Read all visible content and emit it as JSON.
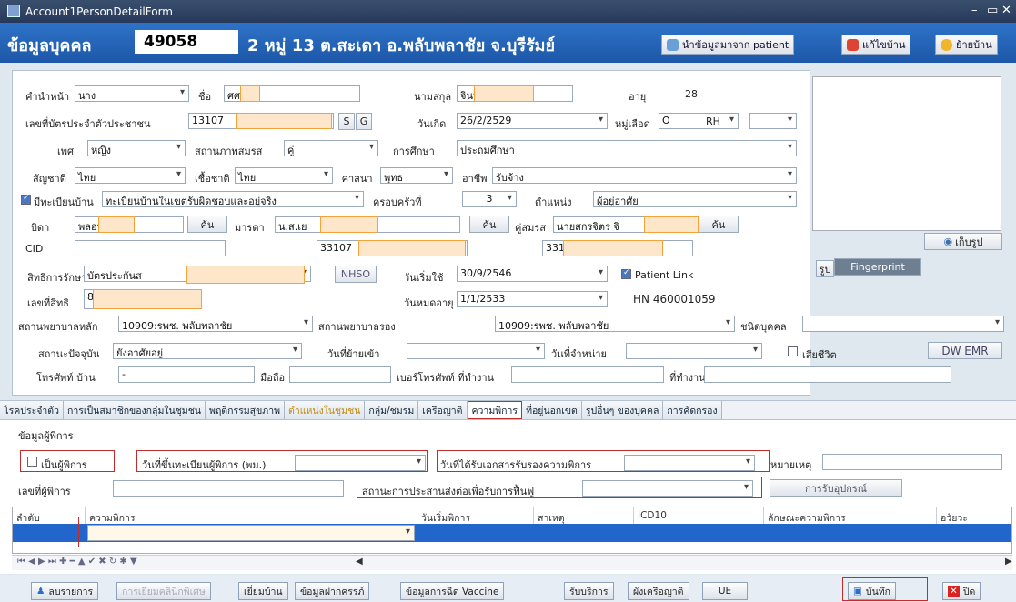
{
  "window": {
    "title": "Account1PersonDetailForm"
  },
  "header": {
    "label": "ข้อมูลบุคคล",
    "person_id": "49058",
    "address": "2 หมู่ 13 ต.สะเดา อ.พลับพลาชัย จ.บุรีรัมย์",
    "btn_import": "นำข้อมูลมาจาก patient",
    "btn_edit_house": "แก้ไขบ้าน",
    "btn_move_house": "ย้ายบ้าน"
  },
  "form": {
    "prefix_label": "คำนำหน้า",
    "prefix": "นาง",
    "name_label": "ชื่อ",
    "name": "ศศ",
    "surname_label": "นามสกุล",
    "surname": "จินป",
    "age_label": "อายุ",
    "age": "28",
    "cid_label": "เลขที่บัตรประจำตัวประชาชน",
    "cid_value": "13107",
    "btn_s": "S",
    "btn_g": "G",
    "dob_label": "วันเกิด",
    "dob": "26/2/2529",
    "blood_label": "หมู่เลือด",
    "blood": "O",
    "rh_label": "RH",
    "sex_label": "เพศ",
    "sex": "หญิง",
    "marital_label": "สถานภาพสมรส",
    "marital": "คู่",
    "edu_label": "การศึกษา",
    "edu": "ประถมศึกษา",
    "nation_label": "สัญชาติ",
    "nation": "ไทย",
    "race_label": "เชื้อชาติ",
    "race": "ไทย",
    "religion_label": "ศาสนา",
    "religion": "พุทธ",
    "occupation_label": "อาชีพ",
    "occupation": "รับจ้าง",
    "house_reg_label": "มีทะเบียนบ้าน",
    "house_reg": "ทะเบียนบ้านในเขตรับผิดชอบและอยู่จริง",
    "family_label": "ครอบครัวที่",
    "family": "3",
    "position_label": "ตำแหน่ง",
    "position": "ผู้อยู่อาศัย",
    "father_label": "บิดา",
    "father": "พลอน บ",
    "search": "ค้น",
    "mother_label": "มารดา",
    "mother": "น.ส.เย",
    "spouse_label": "คู่สมรส",
    "spouse": "นายสกรจิตร จิ",
    "cid2_label": "CID",
    "mother_cid": "33107",
    "spouse_cid": "331",
    "right_label": "สิทธิการรักษา",
    "right": "บัตรประกันส",
    "nhso": "NHSO",
    "start_label": "วันเริ่มใช้",
    "start": "30/9/2546",
    "patient_link": "Patient Link",
    "right_no_label": "เลขที่สิทธิ",
    "right_no": "8",
    "expire_label": "วันหมดอายุ",
    "expire": "1/1/2533",
    "hn": "HN 460001059",
    "main_hosp_label": "สถานพยาบาลหลัก",
    "main_hosp": "10909:รพช. พลับพลาชัย",
    "sub_hosp_label": "สถานพยาบาลรอง",
    "sub_hosp": "10909:รพช. พลับพลาชัย",
    "ptype_label": "ชนิดบุคคล",
    "status_label": "สถานะปัจจุบัน",
    "status": "ยังอาศัยอยู่",
    "movein_label": "วันที่ย้ายเข้า",
    "discharge_label": "วันที่จำหน่าย",
    "dead_label": "เสียชีวิต",
    "dw_emr": "DW EMR",
    "phone_label": "โทรศัพท์ บ้าน",
    "phone": "-",
    "mobile_label": "มือถือ",
    "work_phone_label": "เบอร์โทรศัพท์ ที่ทำงาน",
    "workplace_label": "ที่ทำงาน"
  },
  "photo": {
    "save": "เก็บรูป",
    "tab_photo": "รูป",
    "tab_finger": "Fingerprint"
  },
  "tabs": [
    "โรคประจำตัว",
    "การเป็นสมาชิกของกลุ่มในชุมชน",
    "พฤติกรรมสุขภาพ",
    "ตำแหน่งในชุมชน",
    "กลุ่ม/ชมรม",
    "เครือญาติ",
    "ความพิการ",
    "ที่อยู่นอกเขต",
    "รูปอื่นๆ ของบุคคล",
    "การคัดกรอง"
  ],
  "disability": {
    "section": "ข้อมูลผู้พิการ",
    "is_disabled": "เป็นผู้พิการ",
    "reg_date": "วันที่ขึ้นทะเบียนผู้พิการ (พม.)",
    "cert_date": "วันที่ได้รับเอกสารรับรองความพิการ",
    "note": "หมายเหตุ",
    "disabled_no": "เลขที่ผู้พิการ",
    "rehab": "สถานะการประสานส่งต่อเพื่อรับการฟื้นฟู",
    "equipment": "การรับอุปกรณ์"
  },
  "grid": {
    "columns": [
      "ลำดับ",
      "ความพิการ",
      "วันเริ่มพิการ",
      "สาเหตุ",
      "ICD10",
      "ลักษณะความพิการ",
      "อวัยวะ"
    ]
  },
  "bottom": {
    "delete": "ลบรายการ",
    "clinic": "การเยี่ยมคลินิกพิเศษ",
    "visit": "เยี่ยมบ้าน",
    "prenatal": "ข้อมูลฝากครรภ์",
    "vaccine": "ข้อมูลการฉีด Vaccine",
    "service": "รับบริการ",
    "relatives": "ผังเครือญาติ",
    "ue": "UE",
    "save": "บันทึก",
    "close": "ปิด"
  }
}
